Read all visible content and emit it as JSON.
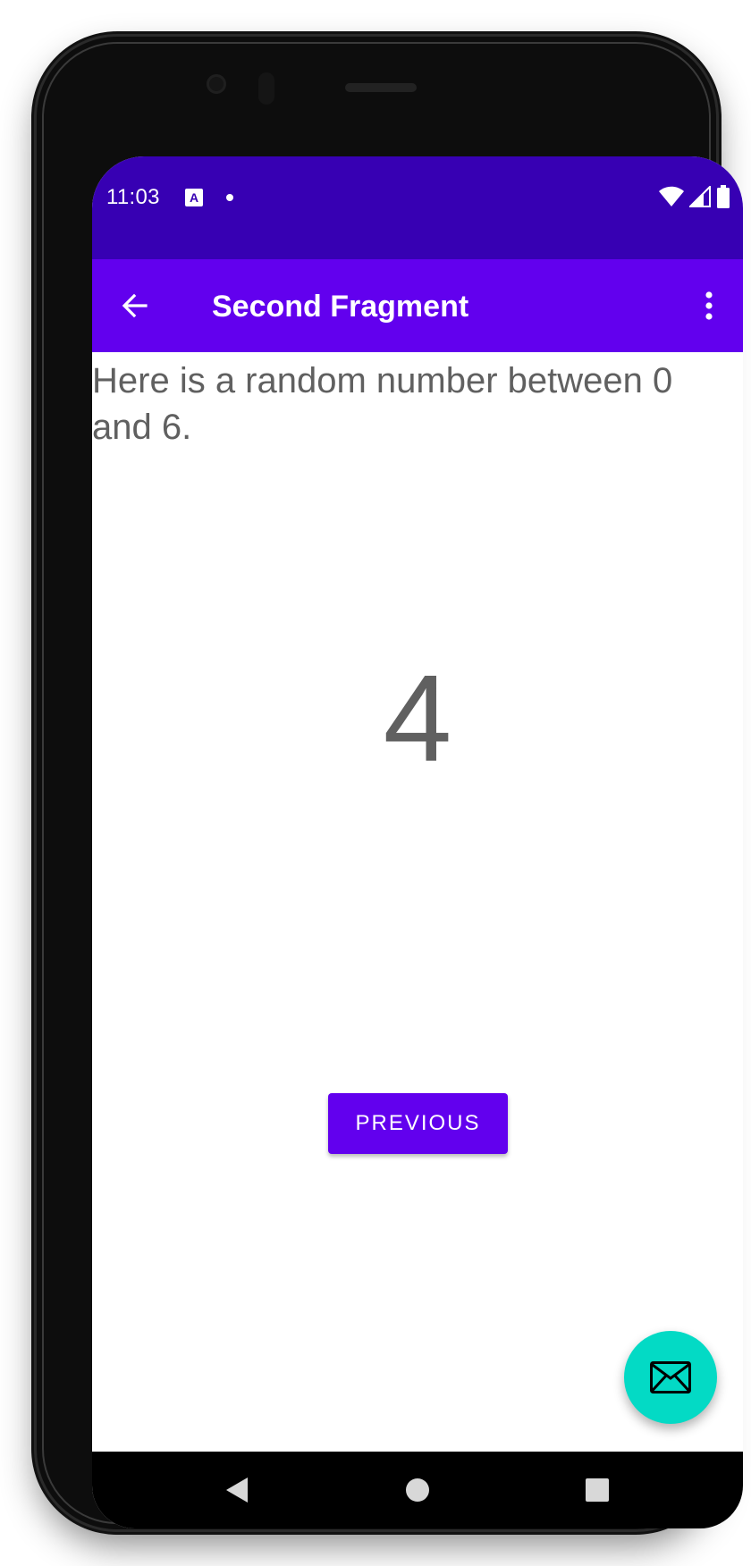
{
  "status_bar": {
    "time": "11:03",
    "notification_icon": "A",
    "icons": [
      "wifi-icon",
      "signal-icon",
      "battery-icon"
    ]
  },
  "app_bar": {
    "title": "Second Fragment",
    "back_icon": "arrow-left-icon",
    "overflow_icon": "more-vert-icon"
  },
  "content": {
    "intro_text": "Here is a random number between 0 and 6.",
    "random_number": "4",
    "previous_button_label": "PREVIOUS"
  },
  "fab": {
    "icon": "email-icon"
  },
  "nav_bar": {
    "buttons": [
      "back-triangle-icon",
      "home-circle-icon",
      "recents-square-icon"
    ]
  },
  "colors": {
    "status_bar": "#3700b3",
    "primary": "#6200ee",
    "secondary": "#03dac5",
    "text": "#606060"
  }
}
